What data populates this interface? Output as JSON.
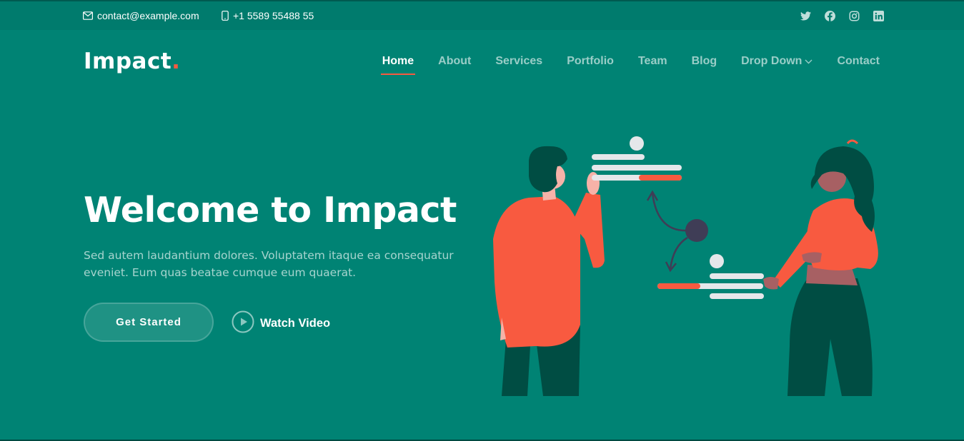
{
  "topbar": {
    "email": "contact@example.com",
    "email_icon": "envelope-icon",
    "phone": "+1 5589 55488 55",
    "phone_icon": "phone-icon",
    "socials": [
      "twitter-icon",
      "facebook-icon",
      "instagram-icon",
      "linkedin-icon"
    ]
  },
  "header": {
    "logo_text": "Impact",
    "logo_dot": ".",
    "nav": [
      {
        "label": "Home",
        "active": true
      },
      {
        "label": "About"
      },
      {
        "label": "Services"
      },
      {
        "label": "Portfolio"
      },
      {
        "label": "Team"
      },
      {
        "label": "Blog"
      },
      {
        "label": "Drop Down",
        "icon": "chevron-down-icon"
      },
      {
        "label": "Contact"
      }
    ]
  },
  "hero": {
    "title": "Welcome to Impact",
    "subtitle": "Sed autem laudantium dolores. Voluptatem itaque ea consequatur eveniet. Eum quas beatae cumque eum quaerat.",
    "cta_primary": "Get Started",
    "cta_secondary": "Watch Video",
    "cta_secondary_icon": "play-circle-icon"
  },
  "colors": {
    "background": "#008374",
    "topbar": "#007b6d",
    "accent": "#f85a40",
    "dark_green": "#004d43"
  }
}
